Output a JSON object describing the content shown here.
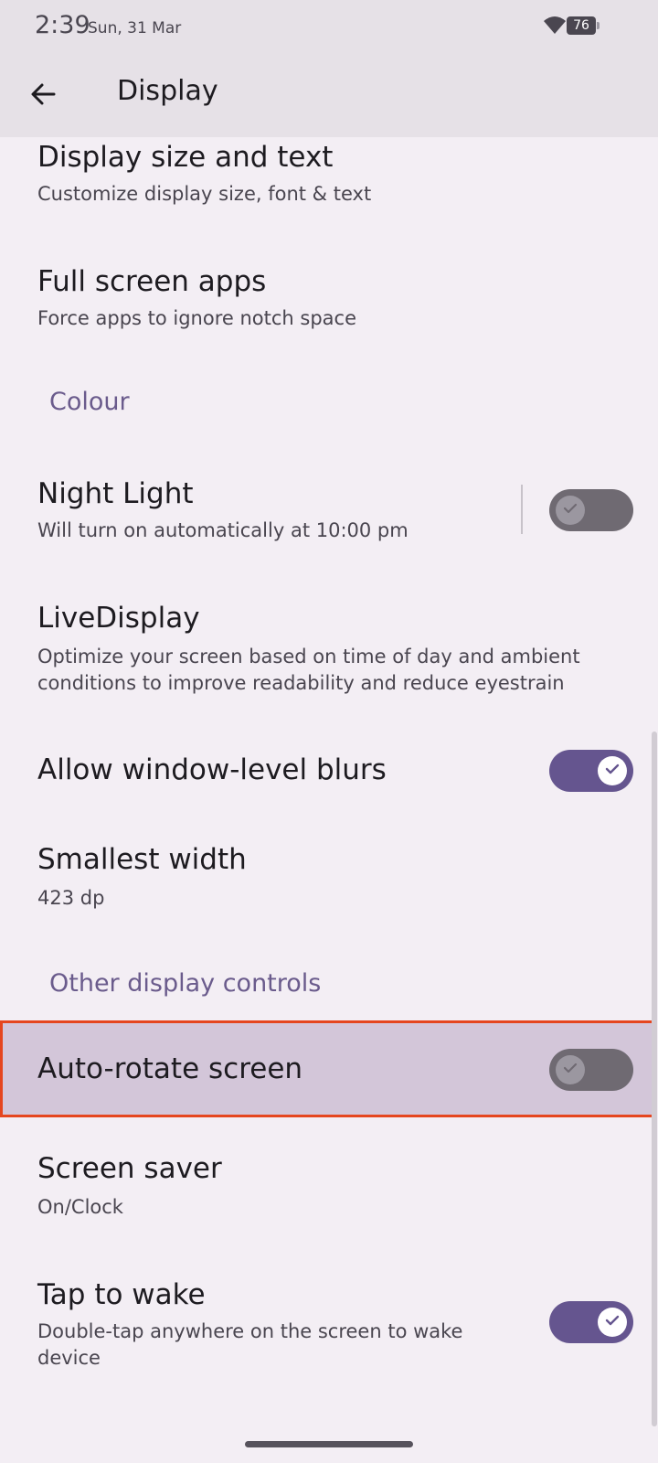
{
  "status_bar": {
    "time": "2:39",
    "date": "Sun, 31 Mar",
    "battery": "76",
    "icons": [
      "wifi-icon",
      "battery-icon"
    ]
  },
  "app_bar": {
    "back_icon": "arrow-left-icon",
    "title": "Display"
  },
  "items": {
    "display_size": {
      "title": "Display size and text",
      "subtitle": "Customize display size, font & text"
    },
    "full_screen": {
      "title": "Full screen apps",
      "subtitle": "Force apps to ignore notch space"
    },
    "colour_header": "Colour",
    "night_light": {
      "title": "Night Light",
      "subtitle": "Will turn on automatically at 10:00 pm",
      "enabled": false
    },
    "live_display": {
      "title": "LiveDisplay",
      "subtitle": "Optimize your screen based on time of day and ambient conditions to improve readability and reduce eyestrain"
    },
    "window_blurs": {
      "title": "Allow window-level blurs",
      "enabled": true
    },
    "smallest_width": {
      "title": "Smallest width",
      "subtitle": "423 dp"
    },
    "other_header": "Other display controls",
    "auto_rotate": {
      "title": "Auto-rotate screen",
      "enabled": false
    },
    "screen_saver": {
      "title": "Screen saver",
      "subtitle": "On/Clock"
    },
    "tap_to_wake": {
      "title": "Tap to wake",
      "subtitle": "Double-tap anywhere on the screen to wake device",
      "enabled": true
    }
  },
  "colors": {
    "accent": "#65558f",
    "section_header": "#6a5b8c",
    "highlight_border": "#e5461f",
    "highlight_fill": "#d3c6d9",
    "background": "#f3eef4"
  }
}
